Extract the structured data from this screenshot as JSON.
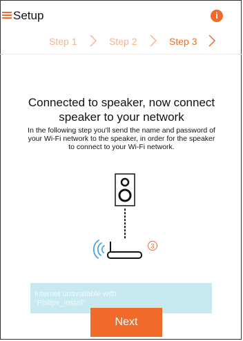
{
  "header": {
    "title": "Setup",
    "info_glyph": "i",
    "menu_icon": "hamburger-menu-icon",
    "info_icon": "info-circle-icon"
  },
  "steps": [
    {
      "label": "Step 1",
      "state": "done"
    },
    {
      "label": "Step 2",
      "state": "done"
    },
    {
      "label": "Step 3",
      "state": "active"
    }
  ],
  "content": {
    "heading_line1": "Connected to speaker, now connect",
    "heading_line2": "speaker to your network",
    "description": "In the following step you'll send the name and password of your Wi-Fi network to the speaker, in order for the speaker to connect to your Wi-Fi network."
  },
  "illustration": {
    "speaker_icon": "speaker-icon",
    "router_icon": "router-icon",
    "wifi_icon": "wifi-signal-icon",
    "badge_number": "3"
  },
  "toast": {
    "text_line1": "Internet unavailable with",
    "text_line2": "\"Philips_Install\""
  },
  "actions": {
    "next_label": "Next"
  },
  "colors": {
    "accent": "#f06b2a",
    "step_inactive": "#f5b58f",
    "toast_bg": "#c7e9ef",
    "wifi_blue": "#4aa6dc"
  }
}
